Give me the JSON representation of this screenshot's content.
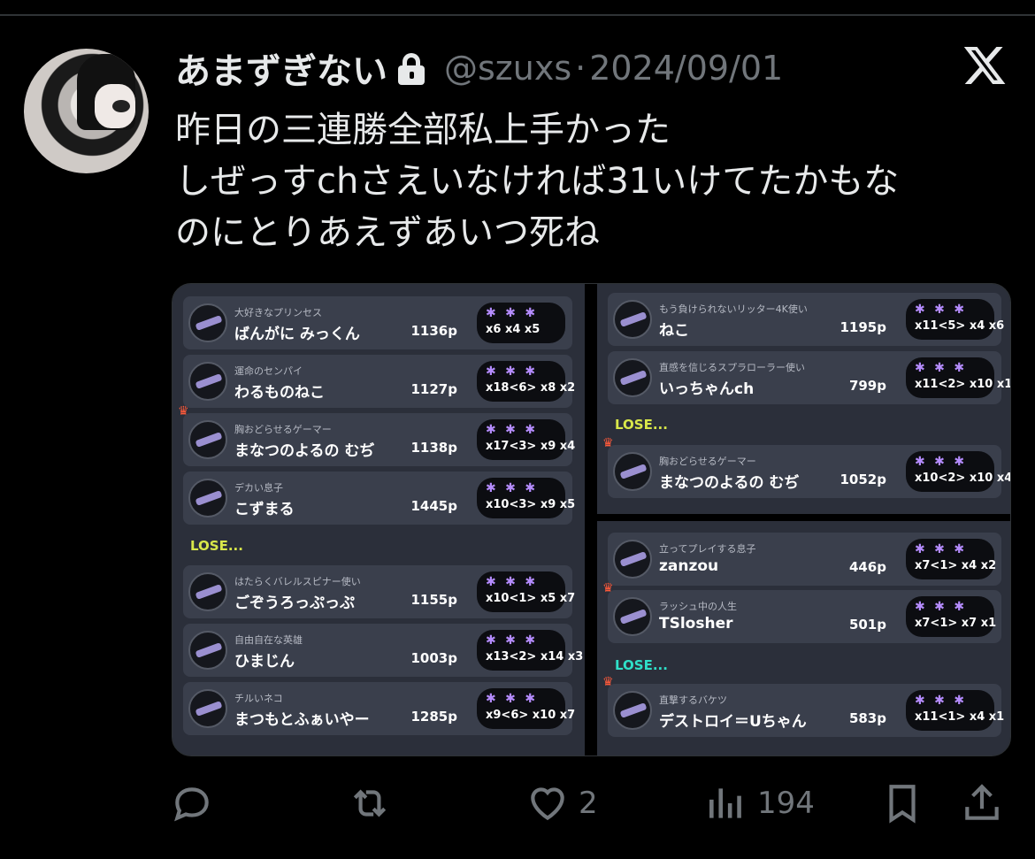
{
  "author": {
    "display_name": "あまずぎない",
    "handle": "@szuxs",
    "separator": "·",
    "timestamp": "2024/09/01"
  },
  "tweet": {
    "text": "昨日の三連勝全部私上手かった\nしぜっすchさえいなければ31いけてたかもな\nのにとりあえずあいつ死ね"
  },
  "left_panel": {
    "win_rows": [
      {
        "title": "大好きなプリンセス",
        "name": "ばんがに みっくん",
        "points": "1136p",
        "vals": "x6  x4  x5"
      },
      {
        "title": "運命のセンパイ",
        "name": "わるものねこ",
        "points": "1127p",
        "vals": "x18<6> x8  x2"
      },
      {
        "title": "胸おどらせるゲーマー",
        "name": "まなつのよるの むぢ",
        "points": "1138p",
        "vals": "x17<3> x9  x4"
      },
      {
        "title": "デカい息子",
        "name": "こずまる",
        "points": "1445p",
        "vals": "x10<3> x9  x5"
      }
    ],
    "lose_label": "LOSE...",
    "lose_rows": [
      {
        "title": "はたらくバレルスピナー使い",
        "name": "ごぞうろっぷっぷ",
        "points": "1155p",
        "vals": "x10<1> x5  x7"
      },
      {
        "title": "自由自在な英雄",
        "name": "ひまじん",
        "points": "1003p",
        "vals": "x13<2> x14 x3"
      },
      {
        "title": "チルいネコ",
        "name": "まつもとふぁいやー",
        "points": "1285p",
        "vals": "x9<6>  x10 x7"
      }
    ]
  },
  "right_top_panel": {
    "win_rows": [
      {
        "title": "もう負けられないリッター4K使い",
        "name": "ねこ",
        "points": "1195p",
        "vals": "x11<5> x4  x6"
      },
      {
        "title": "直感を信じるスプラローラー使い",
        "name": "いっちゃんch",
        "points": "799p",
        "vals": "x11<2> x10 x1"
      }
    ],
    "lose_label": "LOSE...",
    "lose_rows": [
      {
        "title": "胸おどらせるゲーマー",
        "name": "まなつのよるの むぢ",
        "points": "1052p",
        "vals": "x10<2> x10 x4"
      }
    ]
  },
  "right_bottom_panel": {
    "win_rows": [
      {
        "title": "立ってプレイする息子",
        "name": "zanzou",
        "points": "446p",
        "vals": "x7<1> x4  x2"
      },
      {
        "title": "ラッシュ中の人生",
        "name": "TSlosher",
        "points": "501p",
        "vals": "x7<1> x7  x1"
      }
    ],
    "lose_label": "LOSE...",
    "lose_rows": [
      {
        "title": "直撃するバケツ",
        "name": "デストロイ＝Uちゃん",
        "points": "583p",
        "vals": "x11<1> x4  x1"
      }
    ]
  },
  "actions": {
    "likes": "2",
    "views": "194"
  },
  "icons": {
    "reply": "reply-icon",
    "retweet": "retweet-icon",
    "like": "heart-icon",
    "views": "views-icon",
    "bookmark": "bookmark-icon",
    "share": "share-icon",
    "brand": "x-logo-icon",
    "lock": "lock-icon"
  },
  "colors": {
    "text": "#e7e9ea",
    "muted": "#71767b",
    "lose_left": "#d9e84a",
    "lose_right": "#2fe0c8"
  }
}
